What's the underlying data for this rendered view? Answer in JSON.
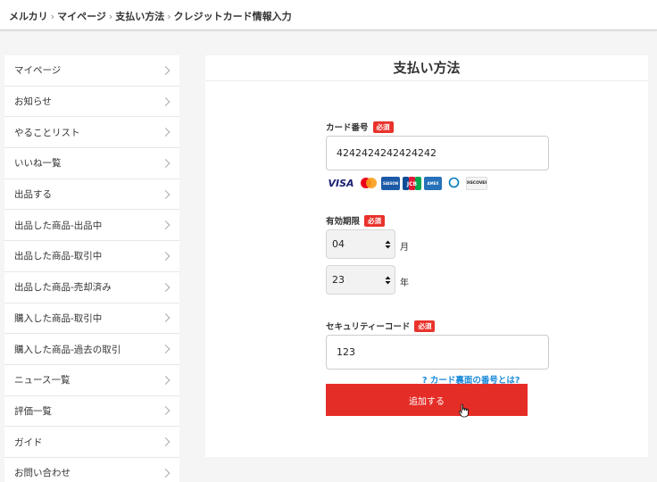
{
  "breadcrumb": {
    "items": [
      "メルカリ",
      "マイページ",
      "支払い方法",
      "クレジットカード情報入力"
    ],
    "separator": "›"
  },
  "sidebar": {
    "items": [
      {
        "label": "マイページ"
      },
      {
        "label": "お知らせ"
      },
      {
        "label": "やることリスト"
      },
      {
        "label": "いいね一覧"
      },
      {
        "label": "出品する"
      },
      {
        "label": "出品した商品-出品中"
      },
      {
        "label": "出品した商品-取引中"
      },
      {
        "label": "出品した商品-売却済み"
      },
      {
        "label": "購入した商品-取引中"
      },
      {
        "label": "購入した商品-過去の取引"
      },
      {
        "label": "ニュース一覧"
      },
      {
        "label": "評価一覧"
      },
      {
        "label": "ガイド"
      },
      {
        "label": "お問い合わせ"
      }
    ]
  },
  "main": {
    "title": "支払い方法",
    "card_number": {
      "label": "カード番号",
      "required": "必須",
      "value": "4242424242424242"
    },
    "card_brands": [
      "VISA",
      "Mastercard",
      "SAISON CARD",
      "JCB",
      "AMERICAN EXPRESS",
      "Diners Club",
      "DISCOVER"
    ],
    "expiry": {
      "label": "有効期限",
      "required": "必須",
      "month": "04",
      "month_unit": "月",
      "year": "23",
      "year_unit": "年"
    },
    "security_code": {
      "label": "セキュリティーコード",
      "required": "必須",
      "value": "123"
    },
    "help_link": "? カード裏面の番号とは?",
    "submit_label": "追加する"
  },
  "colors": {
    "accent": "#e52d27",
    "required_badge": "#e8322b",
    "link": "#1a8ad9",
    "background": "#f5f5f5"
  },
  "icons": [
    "chevron-right-icon",
    "select-arrows-icon",
    "mouse-pointer-icon"
  ]
}
